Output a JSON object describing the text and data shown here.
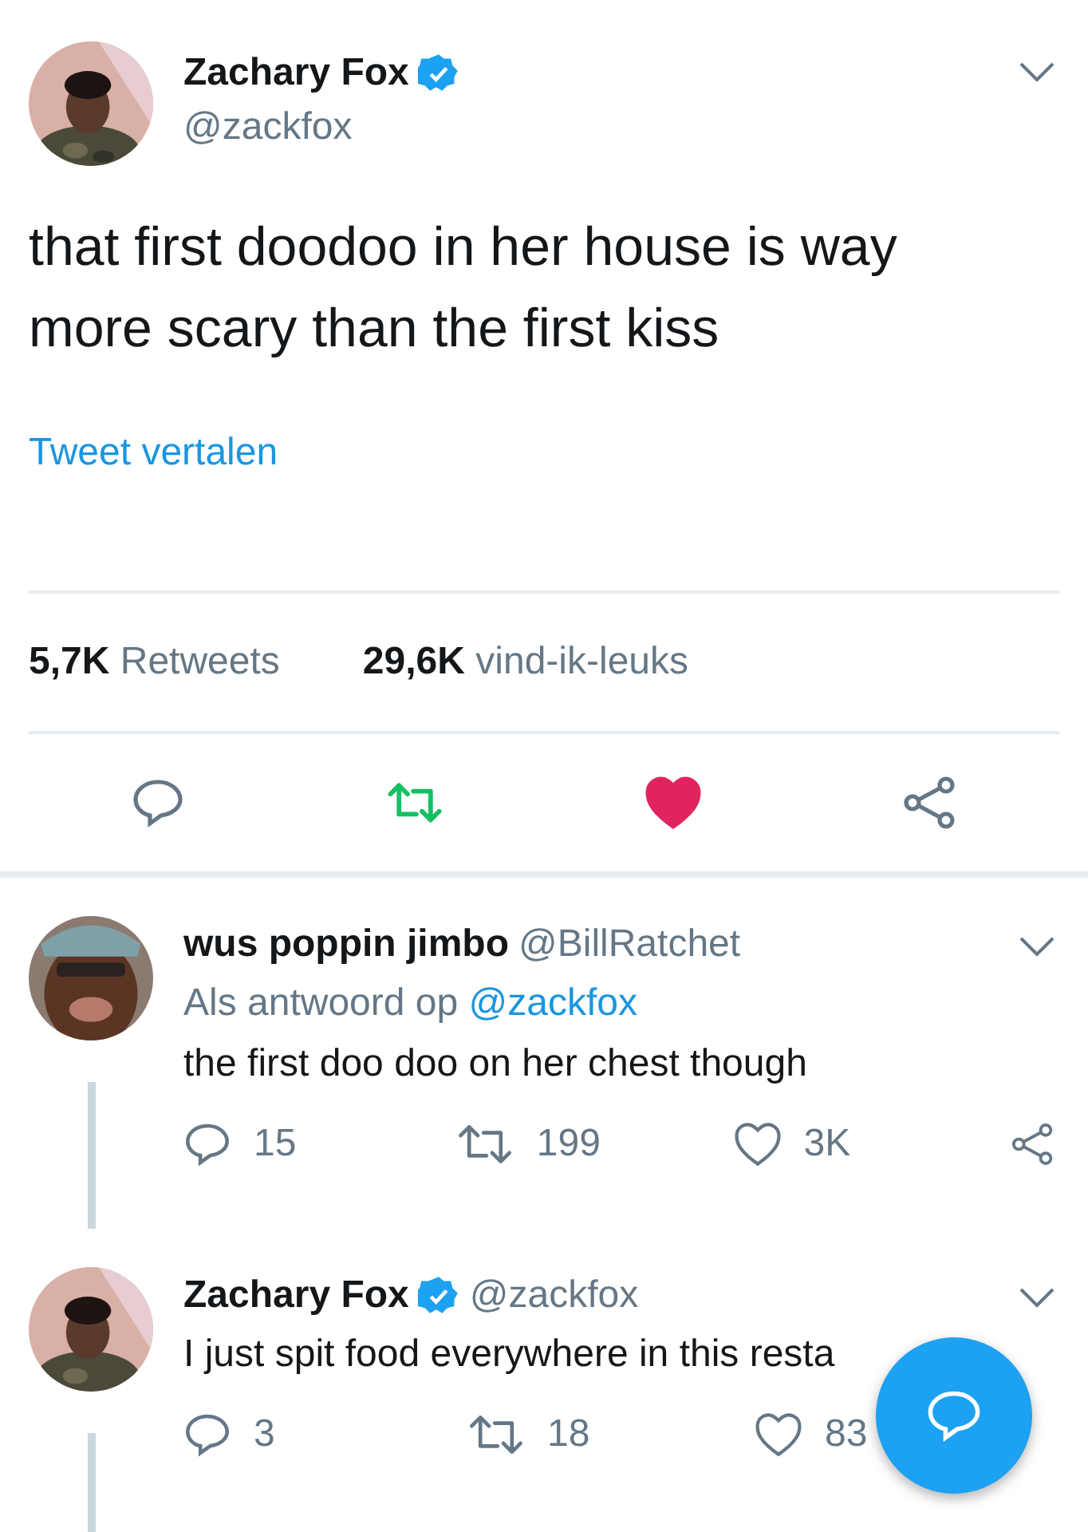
{
  "tweet": {
    "author": {
      "name": "Zachary Fox",
      "handle": "@zackfox",
      "verified": true
    },
    "text": "that first doodoo in her house is way more scary than the first kiss",
    "translate_link": "Tweet vertalen",
    "stats": [
      {
        "count": "5,7K",
        "label": "Retweets"
      },
      {
        "count": "29,6K",
        "label": "vind-ik-leuks"
      }
    ],
    "actions": {
      "retweeted": true,
      "liked": true
    }
  },
  "replies": [
    {
      "name": "wus poppin jimbo",
      "handle": "@BillRatchet",
      "reply_prefix": "Als antwoord op",
      "reply_to": "@zackfox",
      "text": "the first doo doo on her chest though",
      "replies": "15",
      "retweets": "199",
      "likes": "3K",
      "retweeted": false,
      "liked": false
    },
    {
      "name": "Zachary Fox",
      "handle": "@zackfox",
      "verified": true,
      "text": "I just spit food everywhere in this resta",
      "replies": "3",
      "retweets": "18",
      "likes": "83",
      "retweeted": false,
      "liked": false
    }
  ]
}
